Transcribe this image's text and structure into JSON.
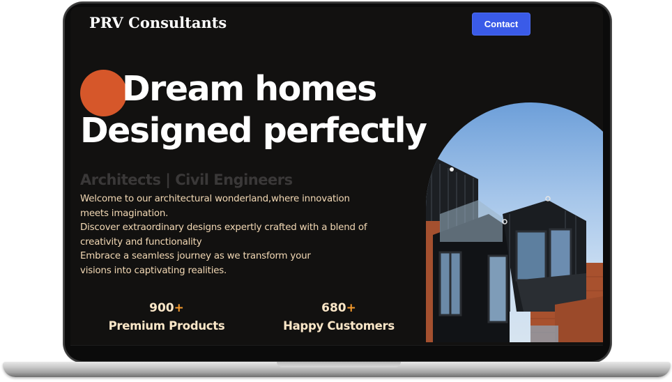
{
  "nav": {
    "logo": "PRV Consultants",
    "contact_label": "Contact"
  },
  "hero": {
    "headline_line1": "Dream homes",
    "headline_line2": "Designed perfectly",
    "subtitle": "Architects | Civil Engineers",
    "description_lines": [
      "Welcome to our architectural wonderland,where innovation",
      "meets imagination.",
      "Discover extraordinary designs expertly crafted with a blend of",
      "creativity and functionality",
      "Embrace a seamless journey as we transform your",
      "visions into captivating realities."
    ]
  },
  "stats": [
    {
      "value": "900",
      "suffix": "+",
      "label": "Premium Products"
    },
    {
      "value": "680",
      "suffix": "+",
      "label": "Happy Customers"
    }
  ],
  "colors": {
    "background": "#121110",
    "accent_circle": "#d6572a",
    "contact_button": "#3a5be8",
    "plus_sign": "#f59a2d",
    "body_text": "#f3d9b5"
  }
}
